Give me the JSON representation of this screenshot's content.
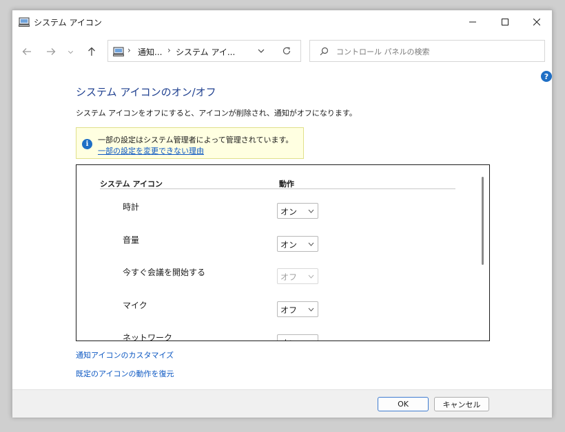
{
  "window": {
    "title": "システム アイコン",
    "icons": {
      "app": "computer-icon",
      "minimize": "minimize-icon",
      "maximize": "maximize-icon",
      "close": "close-icon"
    }
  },
  "nav": {
    "back_icon": "arrow-left-icon",
    "forward_icon": "arrow-right-icon",
    "recent_icon": "chevron-down-icon",
    "up_icon": "arrow-up-icon",
    "breadcrumbs": [
      "通知...",
      "システム アイ..."
    ],
    "separator": "›",
    "refresh_icon": "refresh-icon"
  },
  "search": {
    "placeholder": "コントロール パネルの検索"
  },
  "help": {
    "label": "?"
  },
  "content": {
    "title": "システム アイコンのオン/オフ",
    "description": "システム アイコンをオフにすると、アイコンが削除され、通知がオフになります。",
    "info": {
      "icon_glyph": "i",
      "message": "一部の設定はシステム管理者によって管理されています。",
      "link": "一部の設定を変更できない理由"
    },
    "table": {
      "headers": {
        "icon": "システム アイコン",
        "action": "動作"
      },
      "rows": [
        {
          "label": "時計",
          "value": "オン",
          "disabled": false
        },
        {
          "label": "音量",
          "value": "オン",
          "disabled": false
        },
        {
          "label": "今すぐ会議を開始する",
          "value": "オフ",
          "disabled": true
        },
        {
          "label": "マイク",
          "value": "オフ",
          "disabled": false
        },
        {
          "label": "ネットワーク",
          "value": "オン",
          "disabled": false
        }
      ]
    },
    "links": {
      "customize": "通知アイコンのカスタマイズ",
      "restore": "既定のアイコンの動作を復元"
    }
  },
  "footer": {
    "ok": "OK",
    "cancel": "キャンセル"
  },
  "colors": {
    "accent": "#1f6fc5",
    "title": "#1e3f8f",
    "link": "#0b57c2",
    "info_bg": "#ffffe1"
  }
}
